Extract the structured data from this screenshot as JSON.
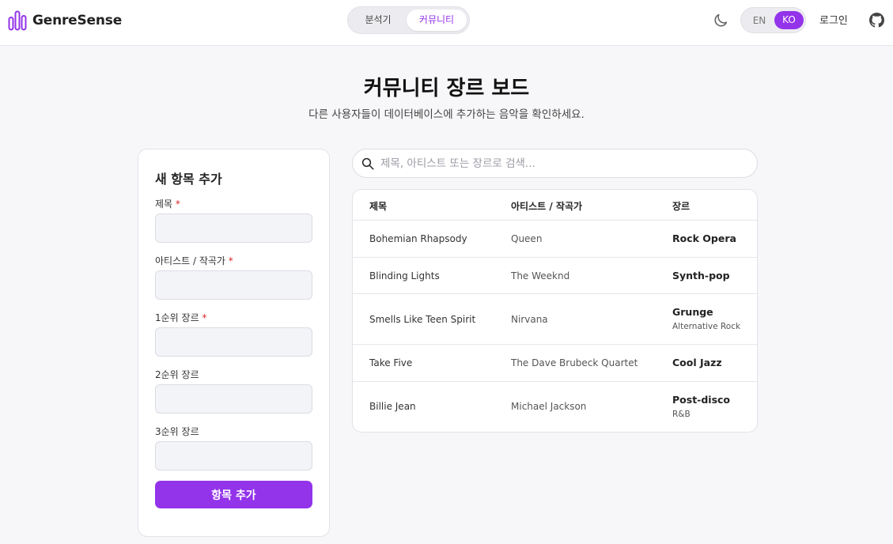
{
  "app": {
    "name": "GenreSense",
    "accent": "#9333ea"
  },
  "nav": {
    "tabs": [
      {
        "label": "분석기"
      },
      {
        "label": "커뮤니티",
        "active": true
      }
    ]
  },
  "header": {
    "lang_en": "EN",
    "lang_ko": "KO",
    "active_lang": "KO",
    "login": "로그인"
  },
  "page": {
    "title": "커뮤니티 장르 보드",
    "subtitle": "다른 사용자들이 데이터베이스에 추가하는 음악을 확인하세요."
  },
  "form": {
    "title": "새 항목 추가",
    "fields": [
      {
        "label": "제목",
        "required": true,
        "value": ""
      },
      {
        "label": "아티스트 / 작곡가",
        "required": true,
        "value": ""
      },
      {
        "label": "1순위 장르",
        "required": true,
        "value": ""
      },
      {
        "label": "2순위 장르",
        "required": false,
        "value": ""
      },
      {
        "label": "3순위 장르",
        "required": false,
        "value": ""
      }
    ],
    "required_mark": "*",
    "submit": "항목 추가"
  },
  "search": {
    "placeholder": "제목, 아티스트 또는 장르로 검색...",
    "value": ""
  },
  "table": {
    "headers": {
      "title": "제목",
      "artist": "아티스트 / 작곡가",
      "genre": "장르"
    },
    "rows": [
      {
        "title": "Bohemian Rhapsody",
        "artist": "Queen",
        "genre": "Rock Opera",
        "subgenre": ""
      },
      {
        "title": "Blinding Lights",
        "artist": "The Weeknd",
        "genre": "Synth-pop",
        "subgenre": ""
      },
      {
        "title": "Smells Like Teen Spirit",
        "artist": "Nirvana",
        "genre": "Grunge",
        "subgenre": "Alternative Rock"
      },
      {
        "title": "Take Five",
        "artist": "The Dave Brubeck Quartet",
        "genre": "Cool Jazz",
        "subgenre": ""
      },
      {
        "title": "Billie Jean",
        "artist": "Michael Jackson",
        "genre": "Post-disco",
        "subgenre": "R&B"
      }
    ]
  }
}
